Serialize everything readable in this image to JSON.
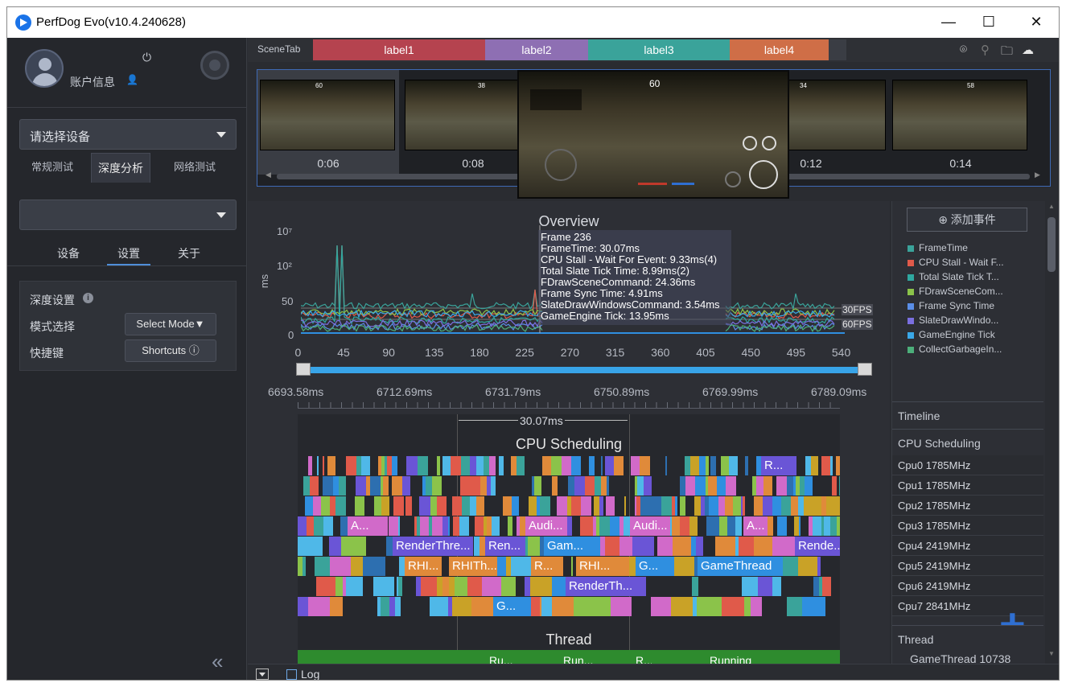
{
  "window": {
    "title": "PerfDog Evo(v10.4.240628)",
    "minimize": "—",
    "maximize": "☐",
    "close": "✕"
  },
  "sidebar": {
    "account_label": "账户信息",
    "device_select": "请选择设备",
    "tabs": [
      "常规测试",
      "深度分析",
      "网络测试"
    ],
    "active_tab": "深度分析",
    "sub_tabs": [
      "设备",
      "设置",
      "关于"
    ],
    "active_sub_tab": "设置",
    "panel": {
      "title": "深度设置",
      "info": "i",
      "mode_label": "模式选择",
      "mode_button": "Select Mode▼",
      "shortcut_label": "快捷键",
      "shortcut_button": "Shortcuts ⓘ"
    },
    "collapse": "«"
  },
  "scene": {
    "tab_label": "SceneTab",
    "labels": [
      {
        "text": "label1",
        "color": "#b5434f"
      },
      {
        "text": "label2",
        "color": "#8e6fb3"
      },
      {
        "text": "label3",
        "color": "#3aa39a"
      },
      {
        "text": "label4",
        "color": "#cf6e47"
      }
    ],
    "icons": [
      "location-icon",
      "pin-icon",
      "folder-icon",
      "cloud-icon"
    ]
  },
  "thumbnails": {
    "times": [
      "0:06",
      "0:08",
      "0:12",
      "0:14"
    ],
    "overlay_values": [
      "60",
      "38",
      "34",
      "58"
    ],
    "big_value": "60"
  },
  "overview": {
    "title": "Overview",
    "y_unit": "ms",
    "y_ticks": [
      "10⁷",
      "10²",
      "50",
      "0"
    ],
    "x_ticks": [
      "0",
      "45",
      "90",
      "135",
      "180",
      "225",
      "270",
      "315",
      "360",
      "405",
      "450",
      "495",
      "540"
    ],
    "fps_lines": [
      "30FPS",
      "60FPS"
    ],
    "tooltip": [
      "Frame 236",
      "FrameTime: 30.07ms",
      "CPU Stall - Wait For Event: 9.33ms(4)",
      "Total Slate Tick Time: 8.99ms(2)",
      "FDrawSceneCommand: 24.36ms",
      "Frame Sync Time: 4.91ms",
      "SlateDrawWindowsCommand: 3.54ms",
      "GameEngine Tick: 13.95ms"
    ]
  },
  "timeline": {
    "time_ticks": [
      "6693.58ms",
      "6712.69ms",
      "6731.79ms",
      "6750.89ms",
      "6769.99ms",
      "6789.09ms"
    ],
    "span": "30.07ms",
    "cpu_title": "CPU Scheduling",
    "thread_title": "Thread",
    "bars": [
      {
        "row": 0,
        "text": "R...",
        "color": "#6a55d6"
      },
      {
        "row": 3,
        "text": "A...",
        "color": "#d16ac9"
      },
      {
        "row": 3,
        "text": "Audi...",
        "color": "#d16ac9"
      },
      {
        "row": 3,
        "text": "Audi...",
        "color": "#d16ac9"
      },
      {
        "row": 3,
        "text": "A...",
        "color": "#d16ac9"
      },
      {
        "row": 4,
        "text": "RenderThre...",
        "color": "#6a55d6"
      },
      {
        "row": 4,
        "text": "Ren...",
        "color": "#6a55d6"
      },
      {
        "row": 4,
        "text": "Gam...",
        "color": "#2f8fe0"
      },
      {
        "row": 4,
        "text": "Rende...",
        "color": "#6a55d6"
      },
      {
        "row": 5,
        "text": "RHI...",
        "color": "#e08a3a"
      },
      {
        "row": 5,
        "text": "RHITh...",
        "color": "#e08a3a"
      },
      {
        "row": 5,
        "text": "R...",
        "color": "#e08a3a"
      },
      {
        "row": 5,
        "text": "RHI...",
        "color": "#e08a3a"
      },
      {
        "row": 5,
        "text": "G...",
        "color": "#2f8fe0"
      },
      {
        "row": 5,
        "text": "GameThread",
        "color": "#2f8fe0"
      },
      {
        "row": 6,
        "text": "RenderTh...",
        "color": "#6a55d6"
      },
      {
        "row": 7,
        "text": "G...",
        "color": "#2f8fe0"
      }
    ],
    "thread_bars": [
      "Ru...",
      "Run...",
      "R...",
      "Running"
    ]
  },
  "right_panel": {
    "add_event": "⊕ 添加事件",
    "legend": [
      {
        "label": "FrameTime",
        "color": "#3aa39a"
      },
      {
        "label": "CPU Stall - Wait F...",
        "color": "#e05a4a"
      },
      {
        "label": "Total Slate Tick T...",
        "color": "#2fa8a0"
      },
      {
        "label": "FDrawSceneCom...",
        "color": "#8bc34a"
      },
      {
        "label": "Frame Sync Time",
        "color": "#5a8ee8"
      },
      {
        "label": "SlateDrawWindo...",
        "color": "#7a6fe0"
      },
      {
        "label": "GameEngine Tick",
        "color": "#3aa8e8"
      },
      {
        "label": "CollectGarbageIn...",
        "color": "#4caf7a"
      }
    ],
    "timeline": "Timeline",
    "cpu_scheduling": "CPU Scheduling",
    "cpus": [
      "Cpu0  1785MHz",
      "Cpu1  1785MHz",
      "Cpu2  1785MHz",
      "Cpu3  1785MHz",
      "Cpu4  2419MHz",
      "Cpu5  2419MHz",
      "Cpu6  2419MHz",
      "Cpu7  2841MHz"
    ],
    "thread": "Thread",
    "thread_item": "GameThread 10738"
  },
  "bottom": {
    "log": "Log"
  }
}
